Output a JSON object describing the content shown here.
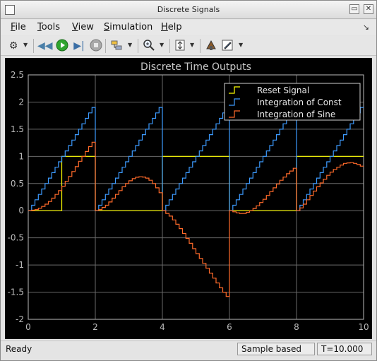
{
  "window": {
    "title": "Discrete  Signals"
  },
  "menu": {
    "items": [
      {
        "label": "File",
        "u": "F",
        "rest": "ile"
      },
      {
        "label": "Tools",
        "u": "T",
        "rest": "ools"
      },
      {
        "label": "View",
        "u": "V",
        "rest": "iew"
      },
      {
        "label": "Simulation",
        "u": "S",
        "rest": "imulation"
      },
      {
        "label": "Help",
        "u": "H",
        "rest": "elp"
      }
    ]
  },
  "toolbar": {
    "icons": [
      "gear-icon",
      "step-back-icon",
      "run-icon",
      "step-forward-icon",
      "stop-icon",
      "signal-selector-icon",
      "zoom-icon",
      "autoscale-icon",
      "highlight-icon",
      "edit-icon"
    ]
  },
  "status": {
    "ready": "Ready",
    "mode": "Sample based",
    "time": "T=10.000"
  },
  "colors": {
    "reset": "#ffff00",
    "const": "#3d9bff",
    "sine": "#ff6a2a",
    "axis": "#bbbbbb",
    "grid": "#6a6a6a"
  },
  "chart_data": {
    "type": "line",
    "title": "Discrete Time Outputs",
    "xlim": [
      0,
      10
    ],
    "ylim": [
      -2,
      2.5
    ],
    "x_ticks": [
      "0",
      "2",
      "4",
      "6",
      "8",
      "10"
    ],
    "y_ticks": [
      "2.5",
      "2",
      "1.5",
      "1",
      "0.5",
      "0",
      "-0.5",
      "-1",
      "-1.5",
      "-2"
    ],
    "grid": true,
    "legend_position": "top-right",
    "series": [
      {
        "name": "Reset Signal",
        "points": [
          [
            0,
            0
          ],
          [
            1,
            0
          ],
          [
            1,
            1
          ],
          [
            2,
            1
          ],
          [
            2,
            0
          ],
          [
            4,
            0
          ],
          [
            4,
            1
          ],
          [
            6,
            1
          ],
          [
            6,
            0
          ],
          [
            8,
            0
          ],
          [
            8,
            1
          ],
          [
            10,
            1
          ]
        ]
      },
      {
        "name": "Integration of Const",
        "sample_time": 0.1,
        "values": [
          0,
          0.1,
          0.2,
          0.3,
          0.4,
          0.5,
          0.6,
          0.7,
          0.8,
          0.9,
          1.0,
          1.1,
          1.2,
          1.3,
          1.4,
          1.5,
          1.6,
          1.7,
          1.8,
          1.9,
          0,
          0.1,
          0.2,
          0.3,
          0.4,
          0.5,
          0.6,
          0.7,
          0.8,
          0.9,
          1.0,
          1.1,
          1.2,
          1.3,
          1.4,
          1.5,
          1.6,
          1.7,
          1.8,
          1.9,
          0,
          0.1,
          0.2,
          0.3,
          0.4,
          0.5,
          0.6,
          0.7,
          0.8,
          0.9,
          1.0,
          1.1,
          1.2,
          1.3,
          1.4,
          1.5,
          1.6,
          1.7,
          1.8,
          1.9,
          0,
          0.1,
          0.2,
          0.3,
          0.4,
          0.5,
          0.6,
          0.7,
          0.8,
          0.9,
          1.0,
          1.1,
          1.2,
          1.3,
          1.4,
          1.5,
          1.6,
          1.7,
          1.8,
          1.9,
          0,
          0.1,
          0.2,
          0.3,
          0.4,
          0.5,
          0.6,
          0.7,
          0.8,
          0.9,
          1.0,
          1.1,
          1.2,
          1.3,
          1.4,
          1.5,
          1.6,
          1.7,
          1.8,
          1.9
        ]
      },
      {
        "name": "Integration of Sine",
        "sample_time": 0.1,
        "values": [
          0,
          0.01,
          0.02,
          0.045,
          0.078,
          0.12,
          0.17,
          0.23,
          0.3,
          0.37,
          0.45,
          0.54,
          0.63,
          0.72,
          0.81,
          0.91,
          1.0,
          1.09,
          1.18,
          1.26,
          0,
          0.02,
          0.06,
          0.1,
          0.16,
          0.23,
          0.3,
          0.37,
          0.44,
          0.5,
          0.55,
          0.59,
          0.615,
          0.625,
          0.62,
          0.6,
          0.56,
          0.5,
          0.42,
          0.33,
          0,
          -0.05,
          -0.1,
          -0.17,
          -0.25,
          -0.33,
          -0.42,
          -0.51,
          -0.6,
          -0.7,
          -0.79,
          -0.88,
          -0.97,
          -1.06,
          -1.15,
          -1.24,
          -1.33,
          -1.42,
          -1.5,
          -1.58,
          0,
          -0.02,
          -0.04,
          -0.05,
          -0.05,
          -0.03,
          0.0,
          0.04,
          0.09,
          0.15,
          0.21,
          0.28,
          0.35,
          0.42,
          0.49,
          0.56,
          0.62,
          0.68,
          0.73,
          0.78,
          0,
          0.05,
          0.12,
          0.2,
          0.28,
          0.36,
          0.44,
          0.51,
          0.58,
          0.65,
          0.71,
          0.76,
          0.8,
          0.84,
          0.87,
          0.88,
          0.885,
          0.87,
          0.85,
          0.82
        ]
      }
    ]
  }
}
